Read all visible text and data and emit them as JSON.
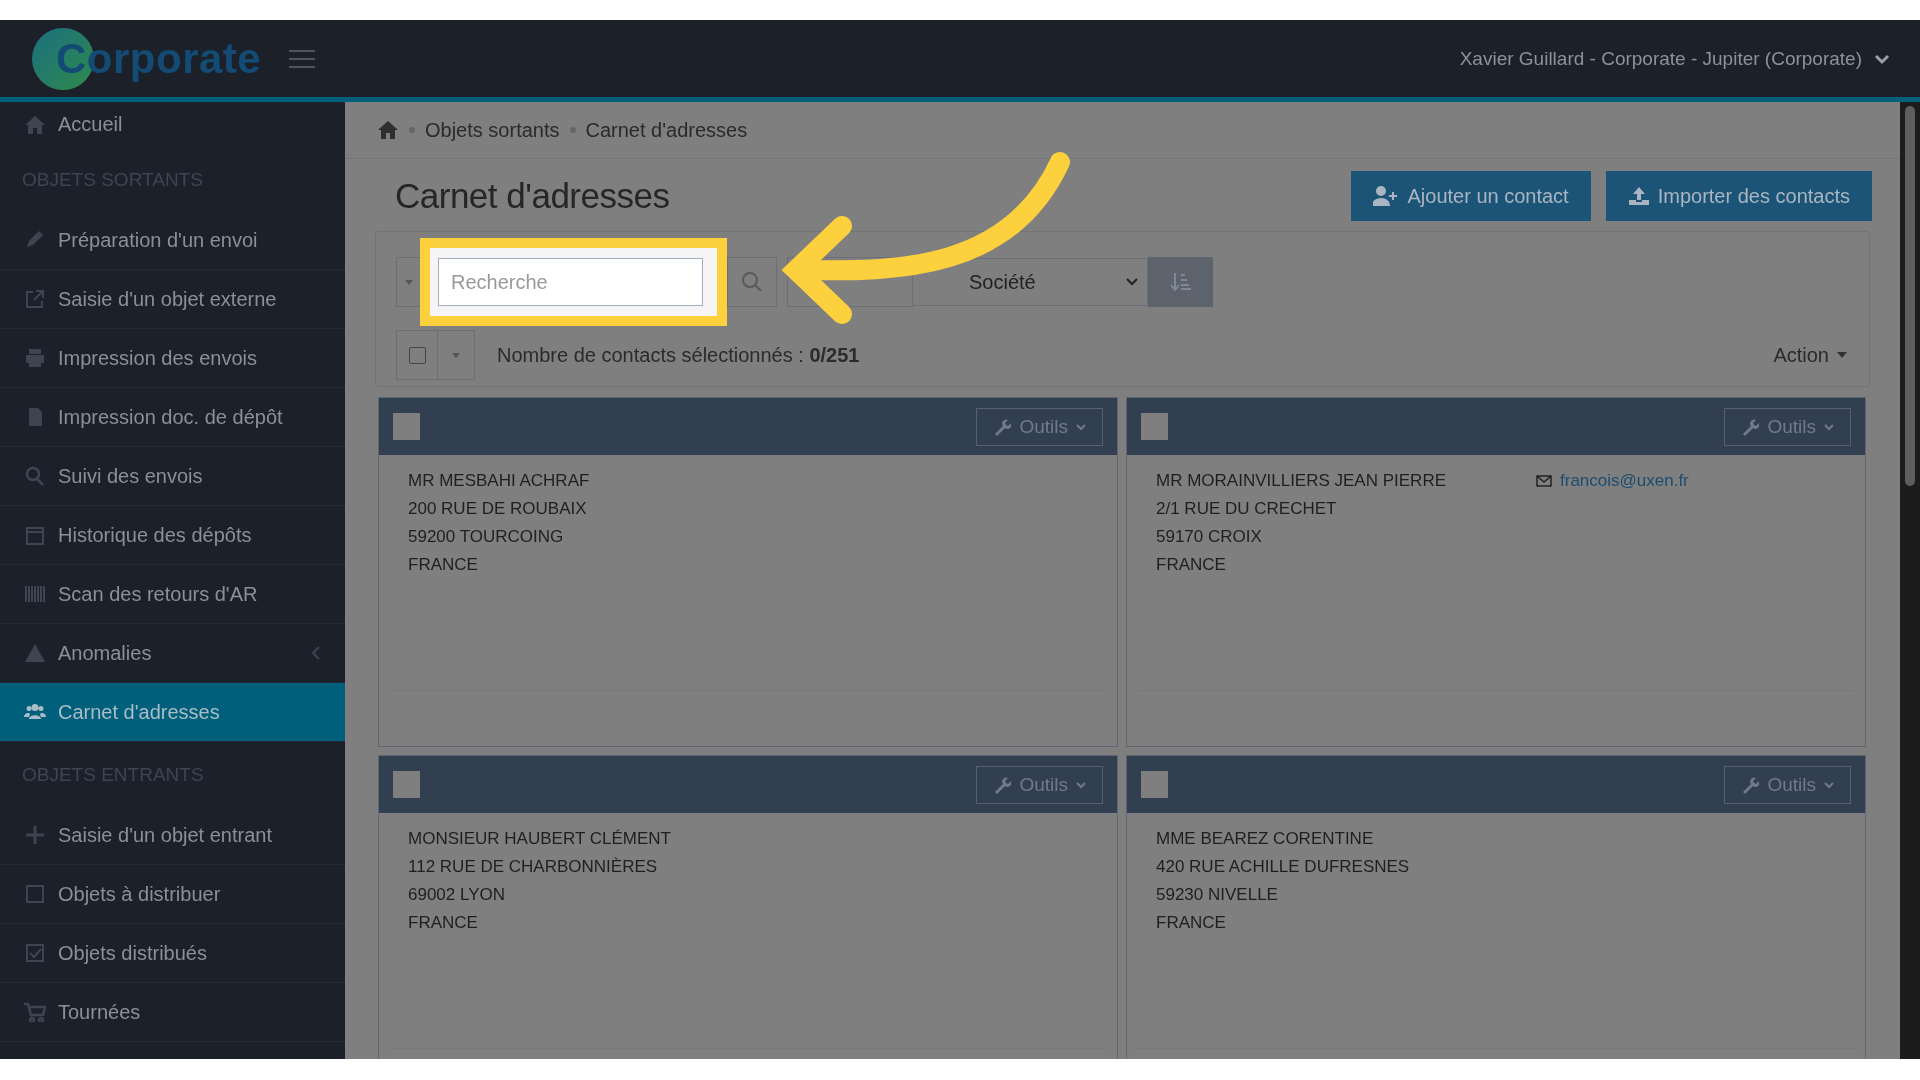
{
  "header": {
    "logo": "Corporate",
    "user": "Xavier Guillard - Corporate - Jupiter (Corporate)"
  },
  "sidebar": [
    {
      "kind": "link",
      "label": "Accueil",
      "selected": false
    },
    {
      "kind": "section",
      "label": "OBJETS SORTANTS"
    },
    {
      "kind": "link",
      "label": "Préparation d'un envoi",
      "selected": false
    },
    {
      "kind": "link",
      "label": "Saisie d'un objet externe",
      "selected": false
    },
    {
      "kind": "link",
      "label": "Impression des envois",
      "selected": false
    },
    {
      "kind": "link",
      "label": "Impression doc. de dépôt",
      "selected": false
    },
    {
      "kind": "link",
      "label": "Suivi des envois",
      "selected": false
    },
    {
      "kind": "link",
      "label": "Historique des dépôts",
      "selected": false
    },
    {
      "kind": "link",
      "label": "Scan des retours d'AR",
      "selected": false
    },
    {
      "kind": "link",
      "label": "Anomalies",
      "selected": false,
      "submenu": true
    },
    {
      "kind": "link",
      "label": "Carnet d'adresses",
      "selected": true
    },
    {
      "kind": "section",
      "label": "OBJETS ENTRANTS"
    },
    {
      "kind": "link",
      "label": "Saisie d'un objet entrant",
      "selected": false
    },
    {
      "kind": "link",
      "label": "Objets à distribuer",
      "selected": false
    },
    {
      "kind": "link",
      "label": "Objets distribués",
      "selected": false
    },
    {
      "kind": "link",
      "label": "Tournées",
      "selected": false
    }
  ],
  "breadcrumb": [
    "Objets sortants",
    "Carnet d'adresses"
  ],
  "title": "Carnet d'adresses",
  "buttons": [
    "Ajouter un contact",
    "Importer des contacts"
  ],
  "search": {
    "placeholder": "Recherche"
  },
  "sort": {
    "value": "Société"
  },
  "selection": {
    "label": "Nombre de contacts sélectionnés : **0/251**",
    "checked": false
  },
  "action": "Action",
  "cards": [
    {
      "tools": "Outils",
      "checked": false,
      "lines": [
        "MR MESBAHI ACHRAF",
        "200 RUE DE ROUBAIX",
        "59200 TOURCOING",
        "FRANCE"
      ]
    },
    {
      "tools": "Outils",
      "checked": false,
      "lines": [
        "MR MORAINVILLIERS JEAN PIERRE",
        "2/1 RUE DU CRECHET",
        "59170 CROIX",
        "FRANCE"
      ],
      "email": "francois@uxen.fr"
    },
    {
      "tools": "Outils",
      "checked": false,
      "lines": [
        "MONSIEUR HAUBERT CLÉMENT",
        "112 RUE DE CHARBONNIÈRES",
        "69002 LYON",
        "FRANCE"
      ]
    },
    {
      "tools": "Outils",
      "checked": false,
      "lines": [
        "MME BEAREZ CORENTINE",
        "420 RUE ACHILLE DUFRESNES",
        "59230 NIVELLE",
        "FRANCE"
      ]
    }
  ]
}
